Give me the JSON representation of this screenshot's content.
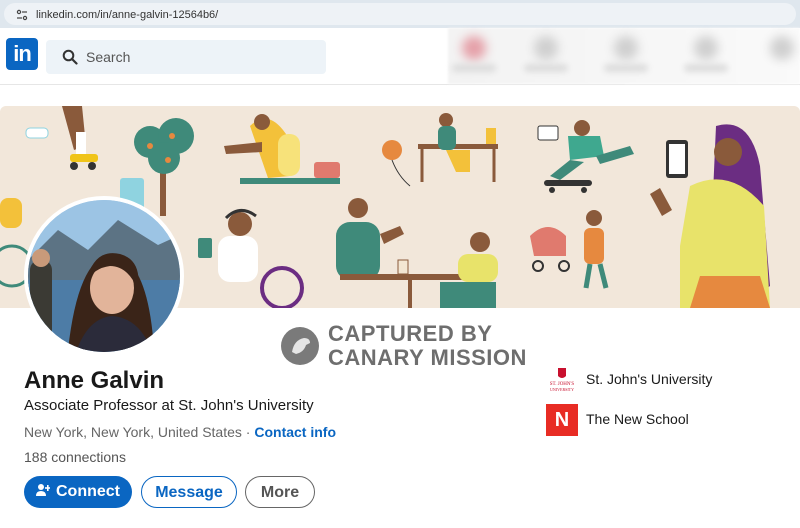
{
  "browser": {
    "url": "linkedin.com/in/anne-galvin-12564b6/",
    "icon": "site-settings-icon"
  },
  "nav": {
    "logo_text": "in",
    "search_placeholder": "Search",
    "search_icon": "search-icon"
  },
  "watermark": {
    "line1": "CAPTURED BY",
    "line2": "CANARY MISSION"
  },
  "profile": {
    "name": "Anne Galvin",
    "headline": "Associate Professor at St. John's University",
    "location": "New York, New York, United States",
    "separator": " · ",
    "contact_info": "Contact info",
    "connections": "188 connections"
  },
  "actions": {
    "connect": "Connect",
    "message": "Message",
    "more": "More"
  },
  "education": [
    {
      "name": "St. John's University",
      "logo_text": "ST. JOHN'S UNIVERSITY"
    },
    {
      "name": "The New School",
      "logo_text": "N"
    }
  ],
  "colors": {
    "linkedin_blue": "#0a66c2",
    "banner_bg": "#f2e7da",
    "new_school_red": "#e82c24"
  }
}
